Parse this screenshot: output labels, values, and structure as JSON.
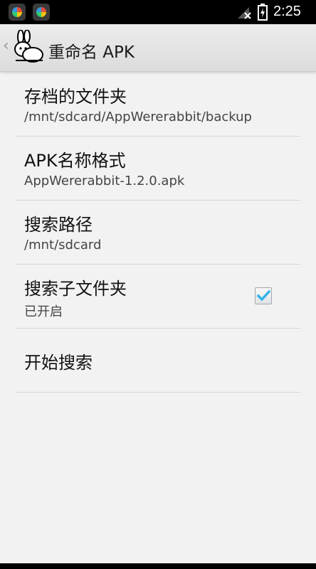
{
  "status_bar": {
    "time": "2:25",
    "icons": [
      "app-notification-icon",
      "app-notification-icon",
      "no-signal-icon",
      "battery-charging-icon"
    ]
  },
  "action_bar": {
    "title": "重命名 APK",
    "logo": "rabbit-logo-icon",
    "up_indicator": "‹"
  },
  "preferences": [
    {
      "title": "存档的文件夹",
      "summary": "/mnt/sdcard/AppWererabbit/backup"
    },
    {
      "title": "APK名称格式",
      "summary": "AppWererabbit-1.2.0.apk"
    },
    {
      "title": "搜索路径",
      "summary": "/mnt/sdcard"
    },
    {
      "title": "搜索子文件夹",
      "summary": "已开启",
      "checked": true
    },
    {
      "title": "开始搜索"
    }
  ],
  "colors": {
    "accent": "#33b5e5",
    "background": "#f2f2f2",
    "status_bar": "#000000"
  }
}
